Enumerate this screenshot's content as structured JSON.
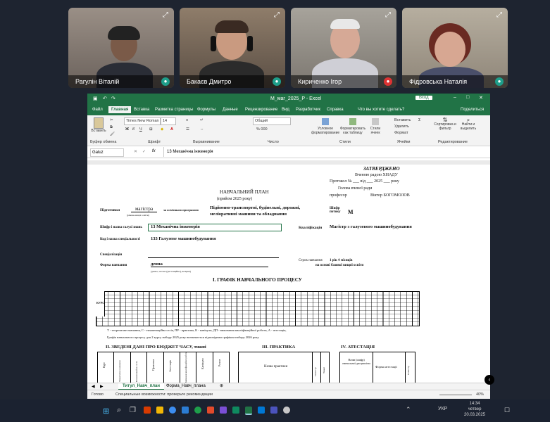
{
  "meeting": {
    "participants": [
      {
        "name": "Рагулін Віталій",
        "mic_muted": false
      },
      {
        "name": "Бакаєв Дмитро",
        "mic_muted": false
      },
      {
        "name": "Кириченко Ігор",
        "mic_muted": true
      },
      {
        "name": "Фідровська Наталія",
        "mic_muted": false
      }
    ]
  },
  "excel": {
    "title": "M_маг_2025_P  -  Excel",
    "signin": "Вход",
    "tabs": [
      "Файл",
      "Главная",
      "Вставка",
      "Разметка страницы",
      "Формулы",
      "Данные",
      "Рецензирование",
      "Вид",
      "Разработчик",
      "Справка",
      "Что вы хотите сделать?"
    ],
    "share": "Поделиться",
    "ribbon": {
      "paste": "Вставить",
      "clipboard": "Буфер обмена",
      "font_name": "Times New Roman",
      "font_size": "14",
      "font_group": "Шрифт",
      "align_group": "Выравнивание",
      "number_format": "Общий",
      "number_group": "Число",
      "cond_format": "Условное форматирование",
      "format_table": "Форматировать как таблицу",
      "cell_styles": "Стили ячеек",
      "styles_group": "Стили",
      "insert": "Вставить",
      "delete": "Удалить",
      "format": "Формат",
      "cells_group": "Ячейки",
      "sort": "Сортировка и фильтр",
      "find": "Найти и выделить",
      "edit_group": "Редактирование"
    },
    "name_box": "Galuz",
    "formula": "13 Механічна інженерія",
    "sheet": {
      "approved": "ЗАТВЕРДЖЕНО",
      "council": "Вченою радою ХНАДУ",
      "protocol": "Протокол № ___ від ___ 2025 ___ року",
      "head": "Голова вченої ради",
      "professor": "професор",
      "signer": "Віктор БОГОМОЛОВ",
      "plan_title": "НАВЧАЛЬНИЙ ПЛАН",
      "admission": "(прийом 2025  року)",
      "training": "Підготовки",
      "level": "магістра",
      "level_note": "(рівень вищої освіти)",
      "program_label": "за освітньою програмою",
      "program": "Підйомно-транспортні, будівельні, дорожні, меліоративні машини та обладнання",
      "code_label": "Шифр потоку",
      "code": "М",
      "field_label": "Шифр і назва галузі знань",
      "field": "13 Механічна інженерія",
      "qual_label": "Кваліфікація",
      "qual": "Магістр з галузевого машинобудування",
      "spec_label": "Код і назва спеціальності",
      "spec": "133 Галузеве машинобудування",
      "specialization": "Спеціалізація",
      "term_label": "Строк навчання",
      "term": "1 рік 4 місяців",
      "basis": "на основі  базової вищої освіти",
      "form_label": "Форма навчання",
      "form": "денна",
      "form_note": "(денна, заочна (дистанційна), вечірня)",
      "schedule": "I. ГРАФІК НАВЧАЛЬНОГО ПРОЦЕСУ",
      "course": "КУРС",
      "legend": "Т - теоретичне навчання, С - екзаменаційна сесія, ПР - практика, К - канікули, ДП - виконання кваліфікаційної роботи, А - атестація,",
      "legend2": "Графік навчального процесу для 2 курсу набору  2025 року       визначається відповідним графіком набору   2026 року",
      "sec2": "II. ЗВЕДЕНІ ДАНІ ПРО БЮДЖЕТ ЧАСУ, тижні",
      "sec3": "III. ПРАКТИКА",
      "sec4": "IV. АТЕСТАЦІЯ",
      "practice_name": "Назва практики",
      "att_name": "Назва (шифр) навчальної дисципліни",
      "att_form": "Форма атестації",
      "semester": "Семестр",
      "weeks": "Тижні",
      "col_heads": [
        "Курс",
        "Теоретичне навчання",
        "Екзаменаційна сесія",
        "Практика",
        "Атестація",
        "Виконання кваліфікаційної роботи",
        "Канікули",
        "Разом"
      ]
    },
    "sheet_tabs": [
      "Титул_Навч_план",
      "Форма_Навч_плана"
    ],
    "status": "Готово",
    "accessibility": "Специальные возможности: проверьте рекомендации",
    "zoom": "40%"
  },
  "taskbar": {
    "lang": "УКР",
    "time": "14:34",
    "day": "четвер",
    "date": "20.03.2025"
  }
}
